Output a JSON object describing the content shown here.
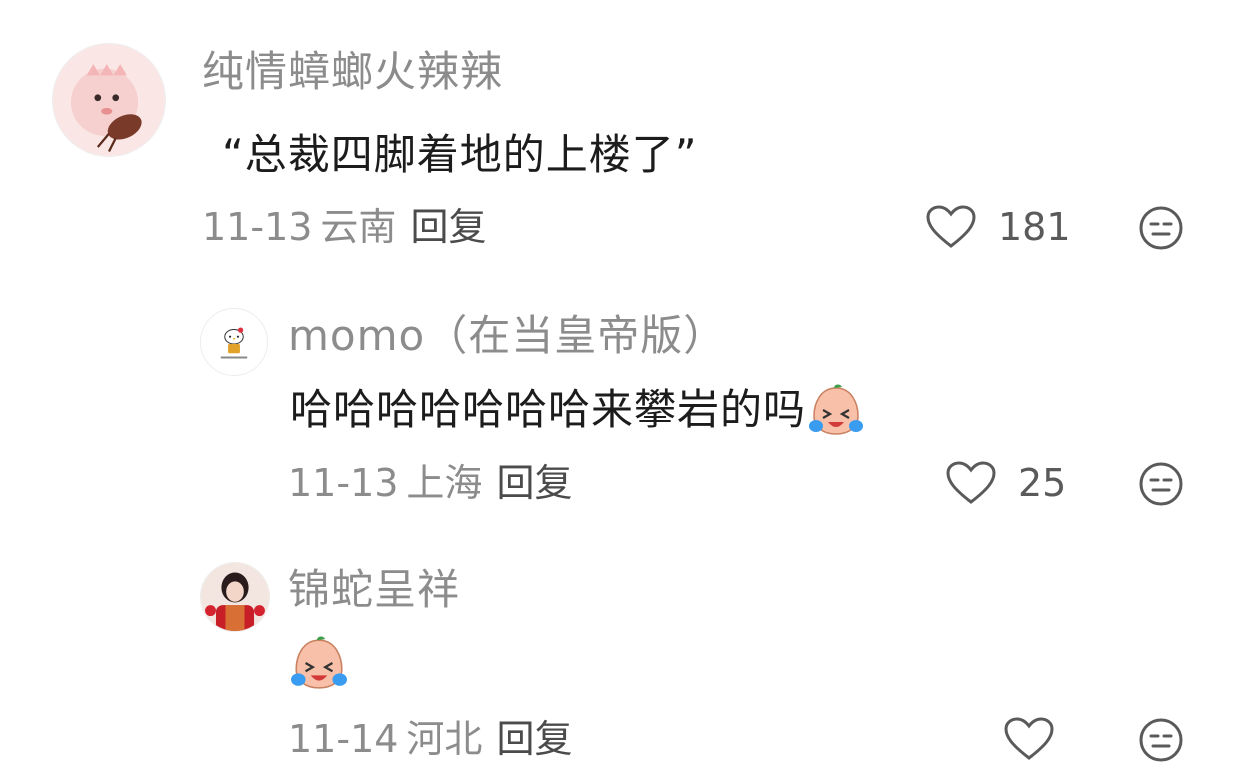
{
  "comments": [
    {
      "username": "纯情蟑螂火辣辣",
      "text": "“总裁四脚着地的上楼了”",
      "date": "11-13",
      "location": "云南",
      "reply_label": "回复",
      "likes": "181",
      "avatar_icon": "pink-cartoon-avatar-icon"
    },
    {
      "username": "momo（在当皇帝版）",
      "text": "哈哈哈哈哈哈哈来攀岩的吗",
      "emoji": "laugh-cry-emoji",
      "date": "11-13",
      "location": "上海",
      "reply_label": "回复",
      "likes": "25",
      "avatar_icon": "hello-kitty-avatar-icon"
    },
    {
      "username": "锦蛇呈祥",
      "text": "",
      "emoji": "laugh-cry-emoji",
      "date": "11-14",
      "location": "河北",
      "reply_label": "回复",
      "likes": "",
      "avatar_icon": "girl-red-outfit-avatar-icon"
    }
  ],
  "colors": {
    "username": "#8c8c8c",
    "text": "#1c1c1c",
    "meta": "#8c8c8c",
    "icon": "#5a5a5a"
  }
}
